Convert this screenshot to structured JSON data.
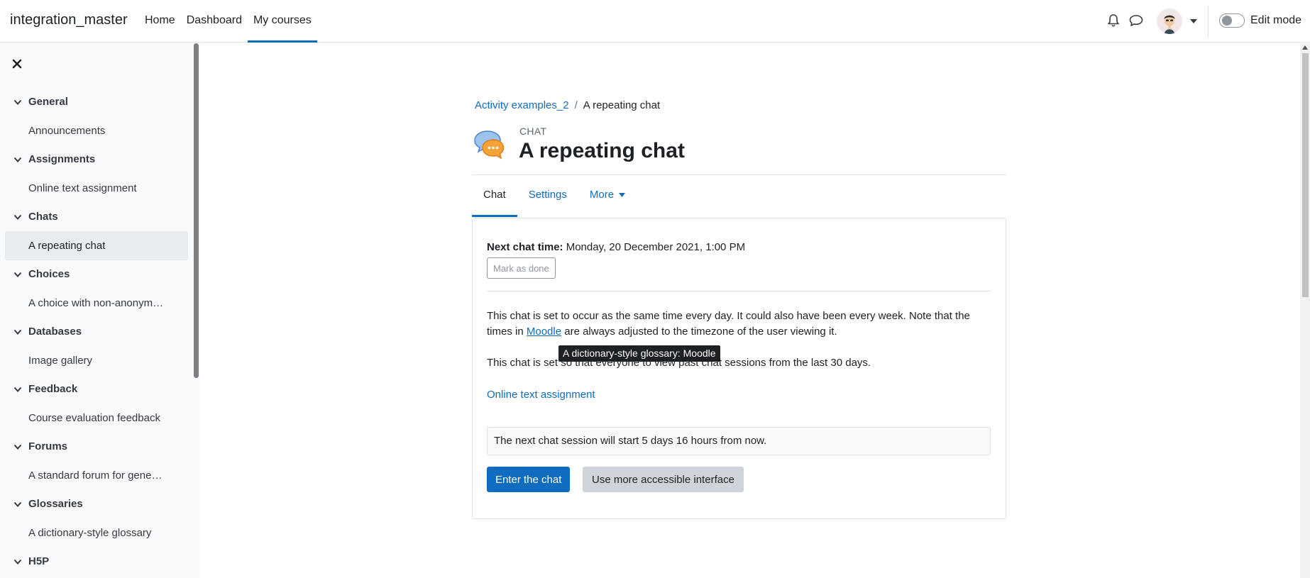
{
  "navbar": {
    "brand": "integration_master",
    "links": [
      "Home",
      "Dashboard",
      "My courses"
    ],
    "active_link": "My courses",
    "icons": [
      "bell-icon",
      "chat-bubble-icon",
      "avatar",
      "chevron-down-icon"
    ],
    "edit_mode_label": "Edit mode",
    "edit_mode_on": false
  },
  "drawer": {
    "close_icon": "close-icon",
    "sections": [
      {
        "title": "General",
        "items": [
          "Announcements"
        ]
      },
      {
        "title": "Assignments",
        "items": [
          "Online text assignment"
        ]
      },
      {
        "title": "Chats",
        "items": [
          "A repeating chat"
        ]
      },
      {
        "title": "Choices",
        "items": [
          "A choice with non-anonym…"
        ]
      },
      {
        "title": "Databases",
        "items": [
          "Image gallery"
        ]
      },
      {
        "title": "Feedback",
        "items": [
          "Course evaluation feedback"
        ]
      },
      {
        "title": "Forums",
        "items": [
          "A standard forum for gene…"
        ]
      },
      {
        "title": "Glossaries",
        "items": [
          "A dictionary-style glossary"
        ]
      },
      {
        "title": "H5P",
        "items": []
      }
    ],
    "active_item": "A repeating chat"
  },
  "breadcrumb": {
    "parent": "Activity examples_2",
    "separator": "/",
    "current": "A repeating chat"
  },
  "header": {
    "module_label": "CHAT",
    "title": "A repeating chat",
    "icon": "chat-bubbles-icon"
  },
  "tabs": {
    "items": [
      "Chat",
      "Settings",
      "More"
    ],
    "active": "Chat"
  },
  "content": {
    "next_time_label": "Next chat time:",
    "next_time_value": "Monday, 20 December 2021, 1:00 PM",
    "mark_done": "Mark as done",
    "para1_before": "This chat is set to occur as the same time every day. It could also have been every week. Note that the times in ",
    "para1_link": "Moodle",
    "para1_after": " are always adjusted to the timezone of the user viewing it.",
    "para2": "This chat is set so that everyone to view past chat sessions from the last 30 days.",
    "assignment_link": "Online text assignment",
    "notice": "The next chat session will start 5 days 16 hours from now.",
    "enter_button": "Enter the chat",
    "accessible_button": "Use more accessible interface",
    "tooltip": "A dictionary-style glossary: Moodle"
  },
  "colors": {
    "primary": "#0f6cbf",
    "text": "#1d2125",
    "drawer_bg": "#f8f9fa",
    "secondary_button": "#ced4da"
  }
}
